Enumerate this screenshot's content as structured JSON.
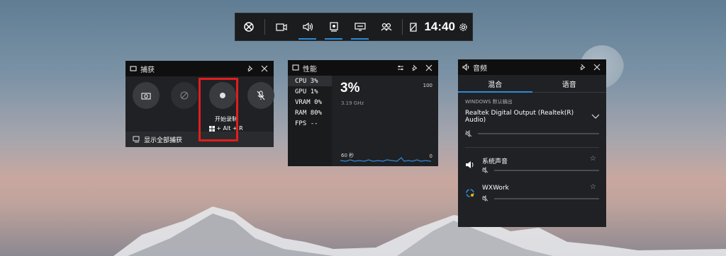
{
  "topbar": {
    "time": "14:40",
    "widgets": [
      "xbox-icon",
      "capture-widget-icon",
      "audio-widget-icon",
      "performance-widget-icon",
      "resources-widget-icon",
      "social-widget-icon"
    ]
  },
  "capture": {
    "title": "捕获",
    "record_label": "开始录制",
    "record_shortcut": "+ Alt + R",
    "footer": "显示全部捕获"
  },
  "performance": {
    "title": "性能",
    "metrics": [
      {
        "name": "CPU",
        "value": "3%"
      },
      {
        "name": "GPU",
        "value": "1%"
      },
      {
        "name": "VRAM",
        "value": "0%"
      },
      {
        "name": "RAM",
        "value": "80%"
      },
      {
        "name": "FPS",
        "value": "--"
      }
    ],
    "big_value": "3%",
    "clock": "3.19 GHz",
    "max_label": "100",
    "min_label": "0",
    "window_label": "60 秒"
  },
  "audio": {
    "title": "音频",
    "tabs": [
      "混合",
      "语音"
    ],
    "section_label": "WINDOWS 默认输出",
    "device": "Realtek Digital Output (Realtek(R) Audio)",
    "apps": [
      {
        "name": "系统声音"
      },
      {
        "name": "WXWork"
      }
    ]
  },
  "colors": {
    "accent": "#2e8ad8",
    "highlight": "#e01e1e",
    "panel": "#202124"
  }
}
